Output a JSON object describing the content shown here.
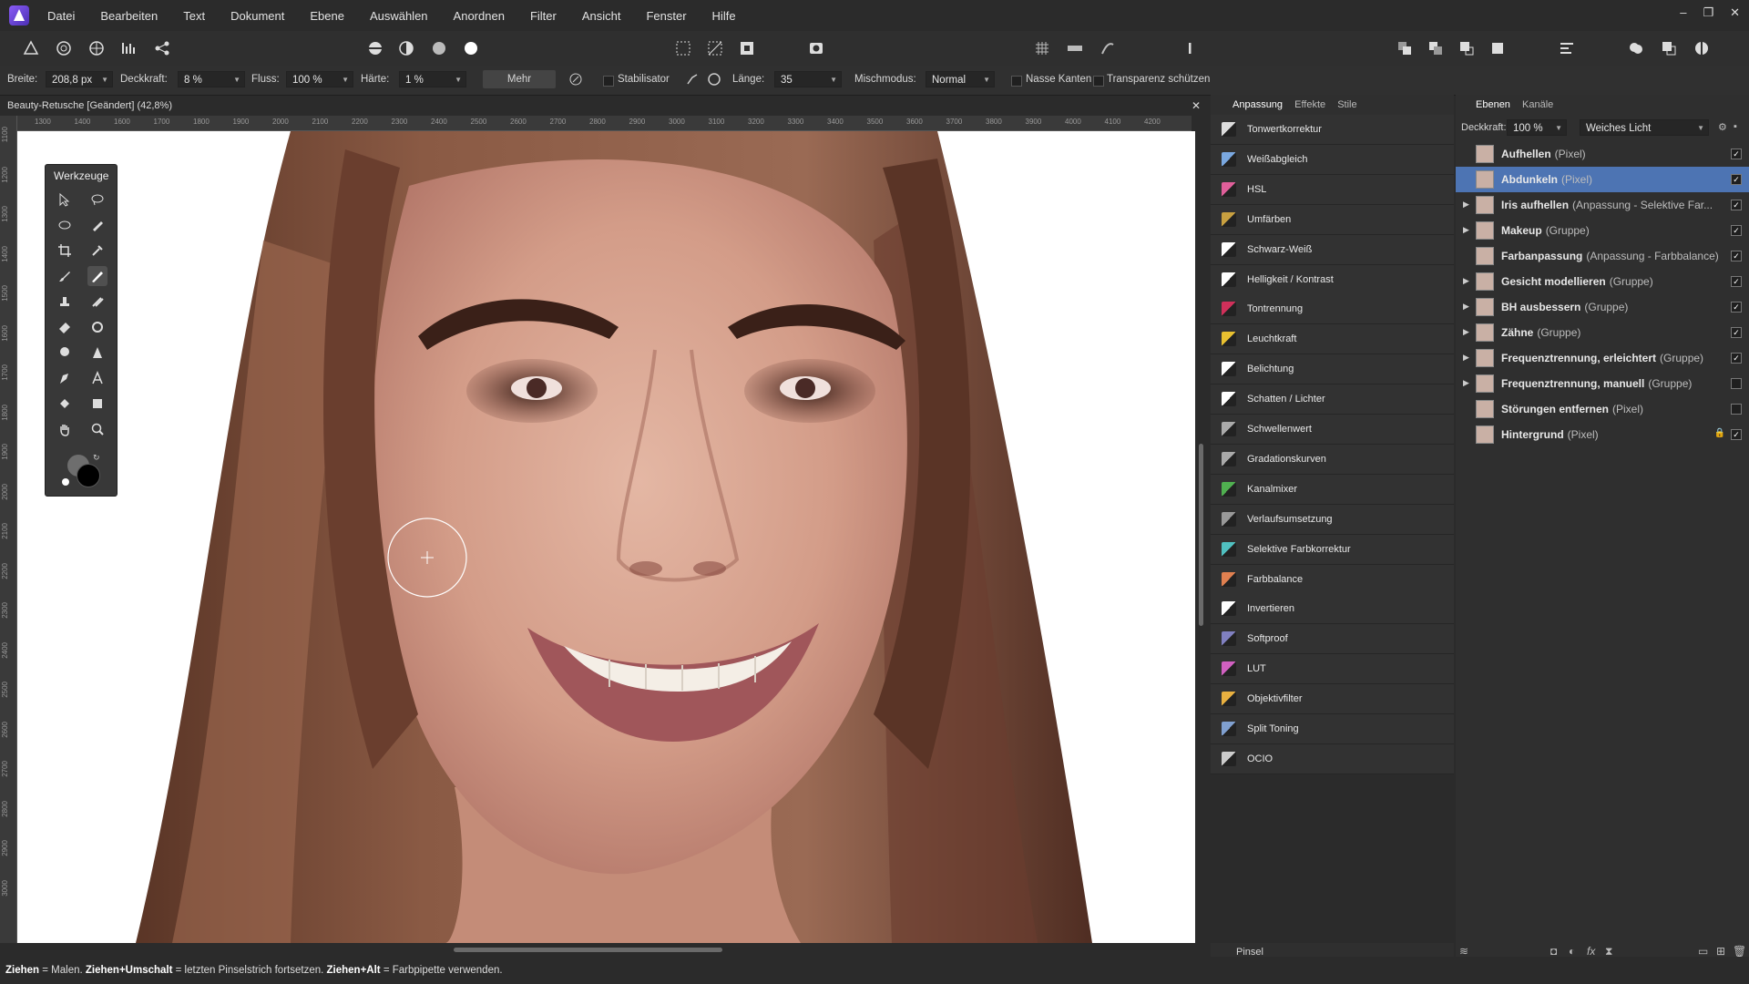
{
  "app": {
    "logo_icon": "affinity-photo-logo-icon"
  },
  "menu": [
    "Datei",
    "Bearbeiten",
    "Text",
    "Dokument",
    "Ebene",
    "Auswählen",
    "Anordnen",
    "Filter",
    "Ansicht",
    "Fenster",
    "Hilfe"
  ],
  "window_controls": {
    "minimize": "–",
    "restore": "❐",
    "close": "✕"
  },
  "context": {
    "breite_label": "Breite:",
    "breite_value": "208,8 px",
    "deckkraft_label": "Deckkraft:",
    "deckkraft_value": "8 %",
    "fluss_label": "Fluss:",
    "fluss_value": "100 %",
    "haerte_label": "Härte:",
    "haerte_value": "1 %",
    "mehr": "Mehr",
    "stabilisator": "Stabilisator",
    "laenge_label": "Länge:",
    "laenge_value": "35",
    "mischmodus_label": "Mischmodus:",
    "mischmodus_value": "Normal",
    "nasse_kanten": "Nasse Kanten",
    "transparenz": "Transparenz schützen"
  },
  "document": {
    "tab_title": "Beauty-Retusche [Geändert] (42,8%)",
    "close": "✕"
  },
  "rulers": {
    "top": [
      "1300",
      "1400",
      "1600",
      "1700",
      "1800",
      "1900",
      "2000",
      "2100",
      "2200",
      "2300",
      "2400",
      "2500",
      "2600",
      "2700",
      "2800",
      "2900",
      "3000",
      "3100",
      "3200",
      "3300",
      "3400",
      "3500",
      "3600",
      "3700",
      "3800",
      "3900",
      "4000",
      "4100",
      "4200"
    ],
    "left": [
      "1100",
      "1200",
      "1300",
      "1400",
      "1500",
      "1600",
      "1700",
      "1800",
      "1900",
      "2000",
      "2100",
      "2200",
      "2300",
      "2400",
      "2500",
      "2600",
      "2700",
      "2800",
      "2900",
      "3000"
    ]
  },
  "tools_panel": {
    "title": "Werkzeuge"
  },
  "adjustment_panel": {
    "tabs": [
      "Anpassung",
      "Effekte",
      "Stile"
    ],
    "items": [
      {
        "label": "Tonwertkorrektur",
        "icon": "levels-icon",
        "color": "#dddddd"
      },
      {
        "label": "Weißabgleich",
        "icon": "white-balance-icon",
        "color": "#7aa8e0"
      },
      {
        "label": "HSL",
        "icon": "hsl-icon",
        "color": "#e05f9a"
      },
      {
        "label": "Umfärben",
        "icon": "recolor-icon",
        "color": "#c8a040"
      },
      {
        "label": "Schwarz-Weiß",
        "icon": "black-white-icon",
        "color": "#ffffff"
      },
      {
        "label": "Helligkeit / Kontrast",
        "icon": "brightness-contrast-icon",
        "color": "#ffffff"
      },
      {
        "label": "Tontrennung",
        "icon": "posterize-icon",
        "color": "#d0305a"
      },
      {
        "label": "Leuchtkraft",
        "icon": "vibrance-icon",
        "color": "#e8c030"
      },
      {
        "label": "Belichtung",
        "icon": "exposure-icon",
        "color": "#ffffff"
      },
      {
        "label": "Schatten / Lichter",
        "icon": "shadows-highlights-icon",
        "color": "#ffffff"
      },
      {
        "label": "Schwellenwert",
        "icon": "threshold-icon",
        "color": "#aaaaaa"
      },
      {
        "label": "Gradationskurven",
        "icon": "curves-icon",
        "color": "#aaaaaa"
      },
      {
        "label": "Kanalmixer",
        "icon": "channel-mixer-icon",
        "color": "#50b050"
      },
      {
        "label": "Verlaufsumsetzung",
        "icon": "gradient-map-icon",
        "color": "#999999"
      },
      {
        "label": "Selektive Farbkorrektur",
        "icon": "selective-color-icon",
        "color": "#50c0c0"
      },
      {
        "label": "Farbbalance",
        "icon": "color-balance-icon",
        "color": "#e08050"
      },
      {
        "label": "Invertieren",
        "icon": "invert-icon",
        "color": "#ffffff"
      },
      {
        "label": "Softproof",
        "icon": "soft-proof-icon",
        "color": "#8080c0"
      },
      {
        "label": "LUT",
        "icon": "lut-icon",
        "color": "#d060c0"
      },
      {
        "label": "Objektivfilter",
        "icon": "lens-filter-icon",
        "color": "#e8b040"
      },
      {
        "label": "Split Toning",
        "icon": "split-toning-icon",
        "color": "#80a0d0"
      },
      {
        "label": "OCIO",
        "icon": "ocio-icon",
        "color": "#cccccc"
      }
    ]
  },
  "layers_panel": {
    "tabs": [
      "Ebenen",
      "Kanäle"
    ],
    "opacity_label": "Deckkraft:",
    "opacity_value": "100 %",
    "blend_mode": "Weiches Licht",
    "layers": [
      {
        "name": "Aufhellen",
        "type": "(Pixel)",
        "expandable": false,
        "checked": true,
        "selected": false
      },
      {
        "name": "Abdunkeln",
        "type": "(Pixel)",
        "expandable": false,
        "checked": true,
        "selected": true
      },
      {
        "name": "Iris aufhellen",
        "type": "(Anpassung - Selektive Far...",
        "expandable": true,
        "checked": true,
        "selected": false
      },
      {
        "name": "Makeup",
        "type": "(Gruppe)",
        "expandable": true,
        "checked": true,
        "selected": false
      },
      {
        "name": "Farbanpassung",
        "type": "(Anpassung - Farbbalance)",
        "expandable": false,
        "checked": true,
        "selected": false
      },
      {
        "name": "Gesicht modellieren",
        "type": "(Gruppe)",
        "expandable": true,
        "checked": true,
        "selected": false
      },
      {
        "name": "BH ausbessern",
        "type": "(Gruppe)",
        "expandable": true,
        "checked": true,
        "selected": false
      },
      {
        "name": "Zähne",
        "type": "(Gruppe)",
        "expandable": true,
        "checked": true,
        "selected": false
      },
      {
        "name": "Frequenztrennung, erleichtert",
        "type": "(Gruppe)",
        "expandable": true,
        "checked": true,
        "selected": false
      },
      {
        "name": "Frequenztrennung, manuell",
        "type": "(Gruppe)",
        "expandable": true,
        "checked": false,
        "selected": false
      },
      {
        "name": "Störungen entfernen",
        "type": "(Pixel)",
        "expandable": false,
        "checked": false,
        "selected": false
      },
      {
        "name": "Hintergrund",
        "type": "(Pixel)",
        "expandable": false,
        "checked": true,
        "selected": false,
        "locked": true
      }
    ]
  },
  "brush_panel": {
    "label": "Pinsel"
  },
  "status": {
    "k1": "Ziehen",
    "t1": " = Malen. ",
    "k2": "Ziehen+Umschalt",
    "t2": " = letzten Pinselstrich fortsetzen. ",
    "k3": "Ziehen+Alt",
    "t3": " = Farbpipette verwenden."
  }
}
